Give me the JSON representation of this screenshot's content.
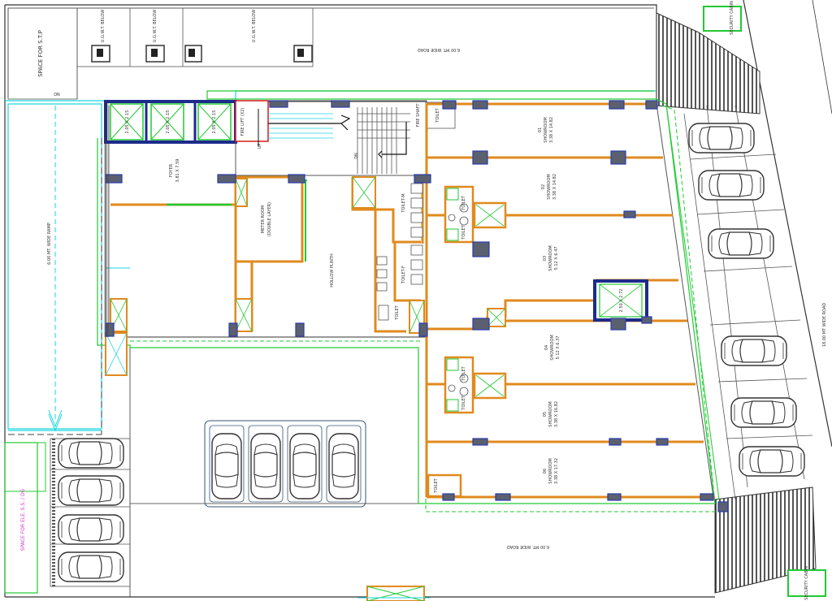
{
  "colors": {
    "wall": "#e08a1e",
    "column": "#5b6070",
    "column_blue": "#2a3da8",
    "lift_frame": "#1c2b8c",
    "boundary": "#22c933",
    "ramp": "#16d6e0",
    "line": "#555555",
    "hatch": "#2b2b2b",
    "magenta": "#d433c9",
    "red": "#d41a1a"
  },
  "labels": {
    "stp": "SPACE FOR S.T.P",
    "ug_tank": "U.G.W.T. BELOW",
    "road_top": "6.00 MT. WIDE ROAD",
    "road_bottom": "6.00 MT. WIDE ROAD",
    "road_right": "18.00 MT WIDE ROAD",
    "ramp": "6.00 MT. WIDE RAMP",
    "ramp_dn": "DN",
    "ele": "SPACE FOR ELE. S.S. / DG",
    "security": "SECURITY CABIN",
    "lift": "2.05 X 2.15",
    "lift_small": "2.50 X 2.72",
    "lobby": "FOYER",
    "lobby_dim": "3.81 X 7.59",
    "meter_room": "METER ROOM",
    "meter_sub": "(DOUBLE LAYER)",
    "hollow": "HOLLOW PLINTH",
    "toilet_block": "TOILET-M",
    "toilet_block2": "TOILET-F",
    "toilet": "TOILET",
    "fire_lift": "FIRE LIFT (X2)",
    "fire_shaft": "FIRE SHAFT",
    "up": "UP",
    "dn_stair": "DN",
    "showroom": "SHOWROOM",
    "showrooms": [
      {
        "num": "01",
        "dim": "3.38 X 14.82"
      },
      {
        "num": "02",
        "dim": "3.38 X 14.82"
      },
      {
        "num": "03",
        "dim": "5.12 X 6.47"
      },
      {
        "num": "04",
        "dim": "5.12 X 6.37"
      },
      {
        "num": "05",
        "dim": "3.38 X 16.82"
      },
      {
        "num": "06",
        "dim": "3.38 X 17.32"
      }
    ]
  }
}
